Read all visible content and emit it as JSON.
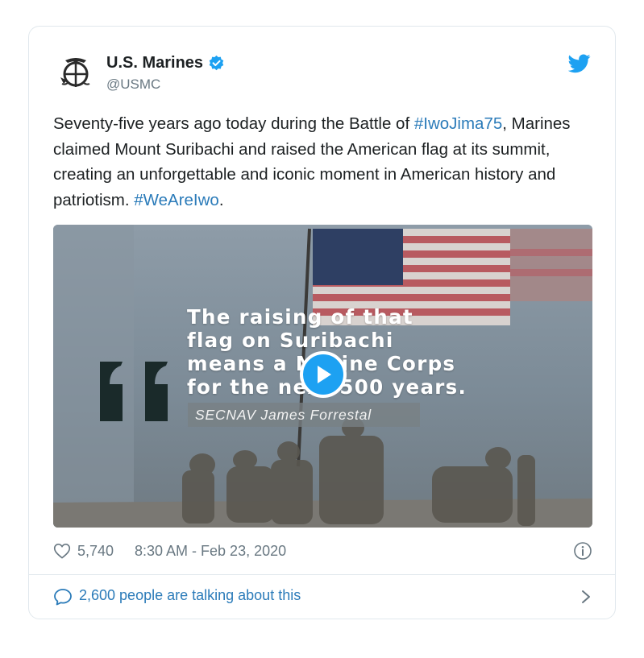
{
  "author": {
    "name": "U.S. Marines",
    "handle": "@USMC"
  },
  "tweet": {
    "text_part1": "Seventy-five years ago today during the Battle of ",
    "hashtag1": "#IwoJima75",
    "text_part2": ",\nMarines claimed Mount Suribachi and raised the American flag at its summit, creating an unforgettable and iconic moment in American history and patriotism. ",
    "hashtag2": "#WeAreIwo",
    "text_part3": "."
  },
  "media": {
    "quote_line1": "The raising of that",
    "quote_line2": "flag on Suribachi",
    "quote_line3": "means a Marine Corps",
    "quote_line4": "for the next 500 years.",
    "attribution": "SECNAV James Forrestal"
  },
  "meta": {
    "likes": "5,740",
    "timestamp": "8:30 AM - Feb 23, 2020"
  },
  "footer": {
    "talking": "2,600 people are talking about this"
  },
  "colors": {
    "accent": "#1da1f2",
    "link": "#2b7bb9",
    "muted": "#697882"
  }
}
